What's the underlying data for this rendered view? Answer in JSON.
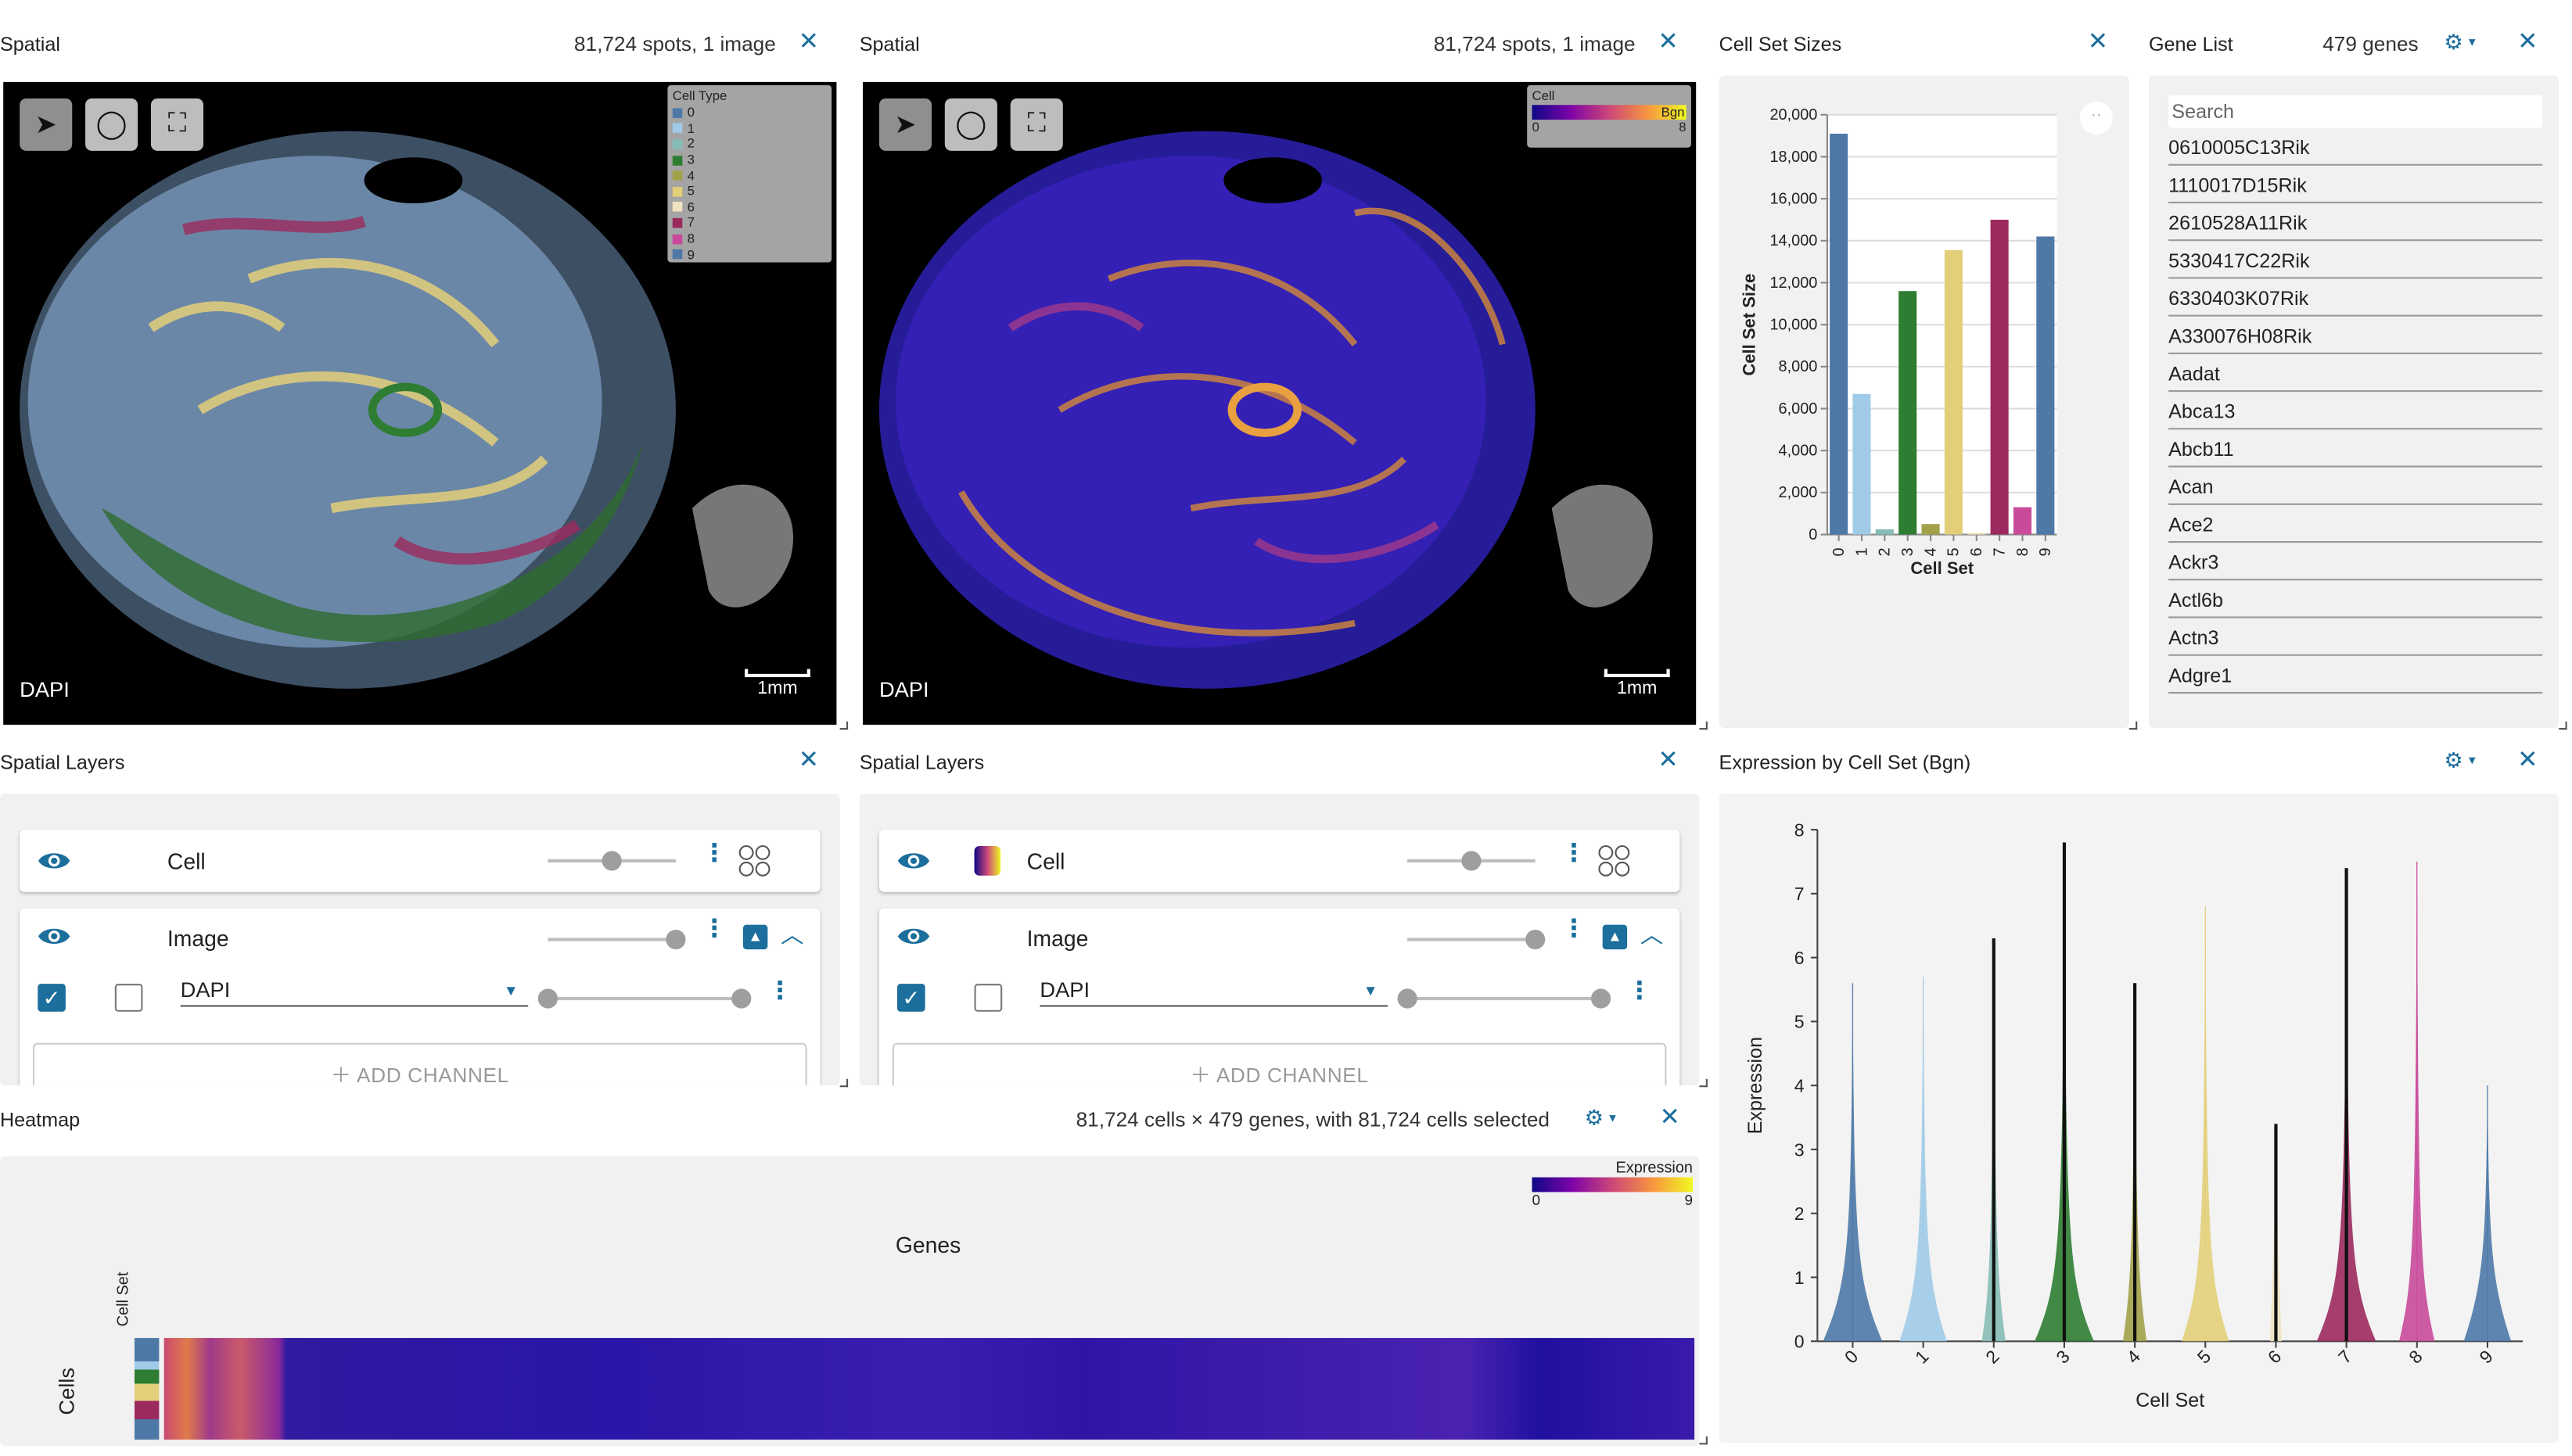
{
  "spatial_left": {
    "title": "Spatial",
    "info": "81,724 spots, 1 image",
    "channel_label": "DAPI",
    "scale_label": "1mm",
    "legend": {
      "title": "Cell Type",
      "items": [
        {
          "label": "0",
          "color": "#4e79a7"
        },
        {
          "label": "1",
          "color": "#a0cbe8"
        },
        {
          "label": "2",
          "color": "#86bcb6"
        },
        {
          "label": "3",
          "color": "#2e7d32"
        },
        {
          "label": "4",
          "color": "#a2a14a"
        },
        {
          "label": "5",
          "color": "#e3cf7a"
        },
        {
          "label": "6",
          "color": "#f0e4c0"
        },
        {
          "label": "7",
          "color": "#9c2a5e"
        },
        {
          "label": "8",
          "color": "#c94a9b"
        },
        {
          "label": "9",
          "color": "#4e79a7"
        }
      ]
    }
  },
  "spatial_right": {
    "title": "Spatial",
    "info": "81,724 spots, 1 image",
    "channel_label": "DAPI",
    "scale_label": "1mm",
    "legend": {
      "title": "Cell",
      "gene": "Bgn",
      "min": "0",
      "max": "8"
    }
  },
  "tools": [
    "pointer-icon",
    "lasso-icon",
    "recenter-icon"
  ],
  "cell_set_sizes": {
    "title": "Cell Set Sizes"
  },
  "gene_list": {
    "title": "Gene List",
    "info": "479 genes",
    "search_placeholder": "Search",
    "genes": [
      "0610005C13Rik",
      "1110017D15Rik",
      "2610528A11Rik",
      "5330417C22Rik",
      "6330403K07Rik",
      "A330076H08Rik",
      "Aadat",
      "Abca13",
      "Abcb11",
      "Acan",
      "Ace2",
      "Ackr3",
      "Actl6b",
      "Actn3",
      "Adgre1"
    ]
  },
  "layers_left": {
    "title": "Spatial Layers",
    "cell_label": "Cell",
    "image_label": "Image",
    "channel": "DAPI",
    "add_channel": "ADD CHANNEL",
    "cell_opacity": 0.5,
    "image_opacity": 1.0
  },
  "layers_right": {
    "title": "Spatial Layers",
    "cell_label": "Cell",
    "image_label": "Image",
    "channel": "DAPI",
    "add_channel": "ADD CHANNEL",
    "cell_opacity": 0.5,
    "image_opacity": 1.0
  },
  "heatmap": {
    "title": "Heatmap",
    "info": "81,724 cells × 479 genes, with 81,724 cells selected",
    "genes_label": "Genes",
    "cells_label": "Cells",
    "cellset_label": "Cell Set",
    "legend_title": "Expression",
    "legend_min": "0",
    "legend_max": "9"
  },
  "violin": {
    "title": "Expression by Cell Set (Bgn)"
  },
  "colors": {
    "accent": "#1c6e9c",
    "c0": "#4e79a7",
    "c1": "#a0cbe8",
    "c2": "#86bcb6",
    "c3": "#2e7d32",
    "c4": "#a2a14a",
    "c5": "#e3cf7a",
    "c6": "#f0e4c0",
    "c7": "#9c2a5e",
    "c8": "#c94a9b",
    "c9": "#4e79a7"
  },
  "chart_data": [
    {
      "type": "bar",
      "title": "",
      "xlabel": "Cell Set",
      "ylabel": "Cell Set Size",
      "categories": [
        "0",
        "1",
        "2",
        "3",
        "4",
        "5",
        "6",
        "7",
        "8",
        "9"
      ],
      "values": [
        19100,
        6700,
        250,
        11600,
        500,
        13550,
        80,
        15000,
        1300,
        14200
      ],
      "ylim": [
        0,
        20000
      ],
      "yticks": [
        0,
        2000,
        4000,
        6000,
        8000,
        10000,
        12000,
        14000,
        16000,
        18000,
        20000
      ],
      "tick_labels": [
        "0",
        "2,000",
        "4,000",
        "6,000",
        "8,000",
        "10,000",
        "12,000",
        "14,000",
        "16,000",
        "18,000",
        "20,000"
      ]
    },
    {
      "type": "violin",
      "title": "",
      "xlabel": "Cell Set",
      "ylabel": "Expression",
      "categories": [
        "0",
        "1",
        "2",
        "3",
        "4",
        "5",
        "6",
        "7",
        "8",
        "9"
      ],
      "max": [
        5.6,
        5.7,
        6.3,
        7.8,
        5.6,
        6.8,
        3.4,
        7.4,
        7.5,
        4.0
      ],
      "mean": [
        0.5,
        0.4,
        0.2,
        0.6,
        0.2,
        0.4,
        0.1,
        0.5,
        0.3,
        0.4
      ],
      "ylim": [
        0,
        8
      ],
      "yticks": [
        0,
        1,
        2,
        3,
        4,
        5,
        6,
        7,
        8
      ]
    }
  ]
}
